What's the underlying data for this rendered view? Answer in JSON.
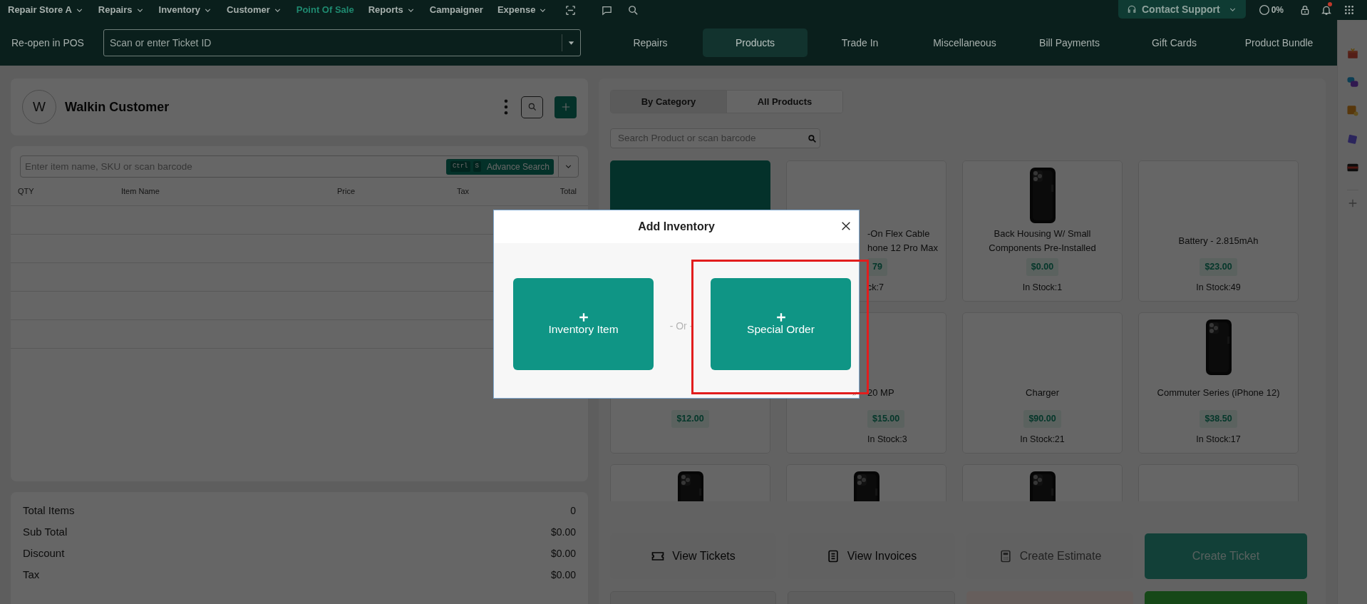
{
  "top_nav": {
    "items": [
      {
        "label": "Repair Store A",
        "dropdown": true,
        "selected": false
      },
      {
        "label": "Repairs",
        "dropdown": true,
        "selected": false
      },
      {
        "label": "Inventory",
        "dropdown": true,
        "selected": false
      },
      {
        "label": "Customer",
        "dropdown": true,
        "selected": false
      },
      {
        "label": "Point Of Sale",
        "dropdown": false,
        "selected": true
      },
      {
        "label": "Reports",
        "dropdown": true,
        "selected": false
      },
      {
        "label": "Campaigner",
        "dropdown": false,
        "selected": false
      },
      {
        "label": "Expense",
        "dropdown": true,
        "selected": false
      }
    ],
    "contact_support": "Contact Support",
    "progress": "0%",
    "notification": true
  },
  "pos_bar": {
    "reopen_label": "Re-open in POS",
    "ticket_field": {
      "placeholder": "Scan or enter Ticket ID"
    },
    "tabs": [
      {
        "label": "Repairs",
        "selected": false
      },
      {
        "label": "Products",
        "selected": true
      },
      {
        "label": "Trade In",
        "selected": false
      },
      {
        "label": "Miscellaneous",
        "selected": false
      },
      {
        "label": "Bill Payments",
        "selected": false
      },
      {
        "label": "Gift Cards",
        "selected": false
      },
      {
        "label": "Product Bundle",
        "selected": false
      }
    ]
  },
  "customer": {
    "initial": "W",
    "name": "Walkin Customer"
  },
  "cart": {
    "search": {
      "placeholder": "Enter item name, SKU or scan barcode"
    },
    "shortcut_keys": [
      "Ctrl",
      "S"
    ],
    "advance_search": "Advance Search",
    "columns": [
      "QTY",
      "Item Name",
      "Price",
      "Tax",
      "Total"
    ]
  },
  "totals": [
    {
      "label": "Total Items",
      "value": "0"
    },
    {
      "label": "Sub Total",
      "value": "$0.00"
    },
    {
      "label": "Discount",
      "value": "$0.00"
    },
    {
      "label": "Tax",
      "value": "$0.00"
    }
  ],
  "catalog": {
    "view_toggle": [
      {
        "label": "By Category",
        "selected": true
      },
      {
        "label": "All Products",
        "selected": false
      }
    ],
    "search": {
      "placeholder": "Search Product or scan barcode"
    },
    "products": [
      {
        "kind": "tile"
      },
      {
        "kind": "covered",
        "has_image": false,
        "name": [
          "-On Flex Cable",
          "hone 12 Pro Max"
        ],
        "price": "79",
        "stock": "ck:7"
      },
      {
        "kind": "product",
        "has_image": true,
        "name": [
          "Back Housing W/ Small",
          "Components Pre-Installed"
        ],
        "price": "$0.00",
        "stock": "In Stock:1"
      },
      {
        "kind": "product",
        "has_image": false,
        "name": [
          "Battery - 2.815mAh"
        ],
        "price": "$23.00",
        "stock": "In Stock:49"
      },
      {
        "kind": "product",
        "price": "$12.00"
      },
      {
        "kind": "covered",
        "has_image": false,
        "name": [
          "20 MP"
        ],
        "price": "$15.00",
        "stock": "In Stock:3"
      },
      {
        "kind": "product",
        "has_image": false,
        "name": [
          "Charger"
        ],
        "price": "$90.00",
        "stock": "In Stock:21"
      },
      {
        "kind": "product",
        "has_image": true,
        "name": [
          "Commuter Series (iPhone 12)"
        ],
        "price": "$38.50",
        "stock": "In Stock:17"
      },
      {
        "kind": "product",
        "has_image": true
      },
      {
        "kind": "product",
        "has_image": true
      },
      {
        "kind": "product",
        "has_image": true
      },
      {
        "kind": "product",
        "has_image": false
      }
    ]
  },
  "actions": [
    {
      "kind": "ticket",
      "label": "View Tickets"
    },
    {
      "kind": "invoice",
      "label": "View Invoices"
    },
    {
      "kind": "estimate",
      "label": "Create Estimate"
    },
    {
      "kind": "primary",
      "label": "Create Ticket"
    }
  ],
  "actions_more": [
    {
      "kind": "plain"
    },
    {
      "kind": "plain"
    },
    {
      "kind": "danger"
    },
    {
      "kind": "success"
    }
  ],
  "modal": {
    "title": "Add Inventory",
    "separator": "- Or -",
    "options": [
      {
        "label": "Inventory Item",
        "highlighted": false
      },
      {
        "label": "Special Order",
        "highlighted": true
      }
    ]
  }
}
